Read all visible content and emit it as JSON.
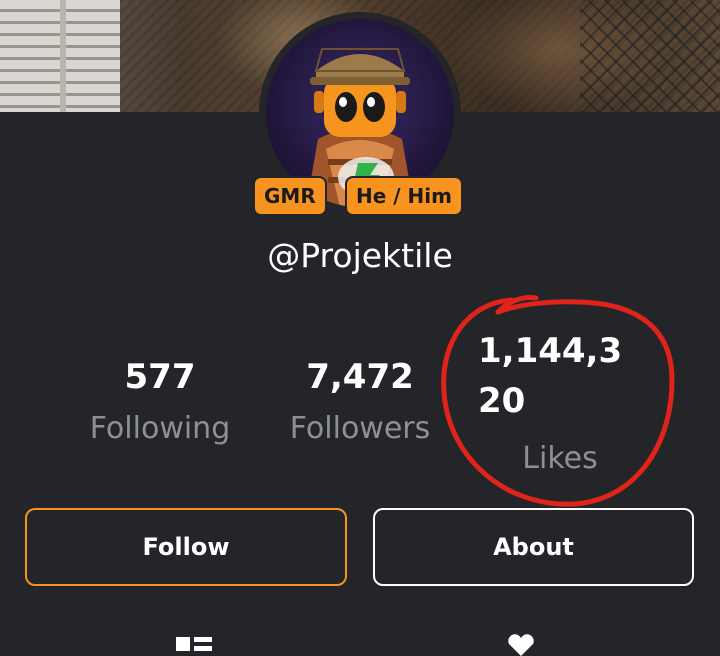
{
  "profile": {
    "username": "@Projektile",
    "badges": [
      "GMR",
      "He / Him"
    ]
  },
  "stats": {
    "following": {
      "value": "577",
      "label": "Following"
    },
    "followers": {
      "value": "7,472",
      "label": "Followers"
    },
    "likes": {
      "value": "1,144,320",
      "label": "Likes"
    }
  },
  "actions": {
    "follow_label": "Follow",
    "about_label": "About"
  },
  "tabs": [
    {
      "icon": "grid-icon"
    },
    {
      "icon": "heart-icon"
    }
  ],
  "colors": {
    "background": "#232529",
    "accent": "#f7931e",
    "muted_text": "#8e9095",
    "annotation": "#e0231b"
  }
}
